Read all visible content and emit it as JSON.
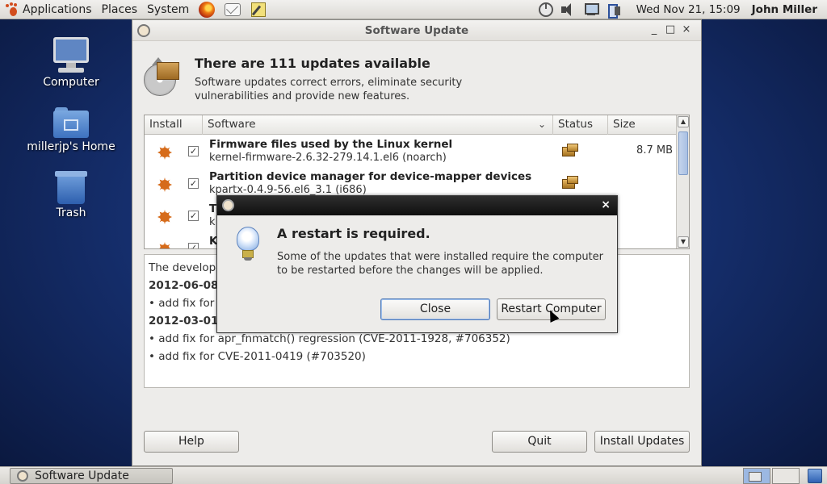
{
  "top_panel": {
    "menus": [
      "Applications",
      "Places",
      "System"
    ],
    "clock": "Wed Nov 21, 15:09",
    "user": "John Miller",
    "launchers": [
      "firefox-icon",
      "mail-icon",
      "notes-icon"
    ],
    "tray_icons": [
      "power-icon",
      "speaker-icon",
      "network-icon",
      "battery-icon"
    ]
  },
  "desktop": {
    "icons": [
      {
        "label": "Computer",
        "icon": "computer-icon"
      },
      {
        "label": "millerjp's Home",
        "icon": "home-folder-icon"
      },
      {
        "label": "Trash",
        "icon": "trash-icon"
      }
    ]
  },
  "window": {
    "title": "Software Update",
    "controls": [
      "_",
      "□",
      "×"
    ],
    "header_title": "There are 111 updates available",
    "header_desc": "Software updates correct errors, eliminate security vulnerabilities and provide new features.",
    "columns": {
      "install": "Install",
      "software": "Software",
      "status": "Status",
      "size": "Size"
    },
    "rows": [
      {
        "name": "Firmware files used by the Linux kernel",
        "pkg": "kernel-firmware-2.6.32-279.14.1.el6 (noarch)",
        "size": "8.7 MB",
        "checked": "✓"
      },
      {
        "name": "Partition device manager for device-mapper devices",
        "pkg": "kpartx-0.4.9-56.el6_3.1 (i686)",
        "size": "",
        "checked": "✓"
      },
      {
        "name": "T",
        "pkg": "k",
        "size": "",
        "checked": "✓"
      },
      {
        "name": "K",
        "pkg": "",
        "size": "",
        "checked": "✓"
      }
    ],
    "changelog": [
      "The develope",
      "2012-06-08",
      "• add fix for",
      "2012-03-01",
      "• add fix for apr_fnmatch() regression (CVE-2011-1928, #706352)",
      "• add fix for CVE-2011-0419 (#703520)"
    ],
    "buttons": {
      "help": "Help",
      "quit": "Quit",
      "install": "Install Updates"
    }
  },
  "dialog": {
    "title": "A restart is required.",
    "message": "Some of the updates that were installed require the computer to be restarted before the changes will be applied.",
    "close_label": "Close",
    "restart_label": "Restart Computer",
    "close_x": "×"
  },
  "bottom_panel": {
    "task_label": "Software Update"
  }
}
